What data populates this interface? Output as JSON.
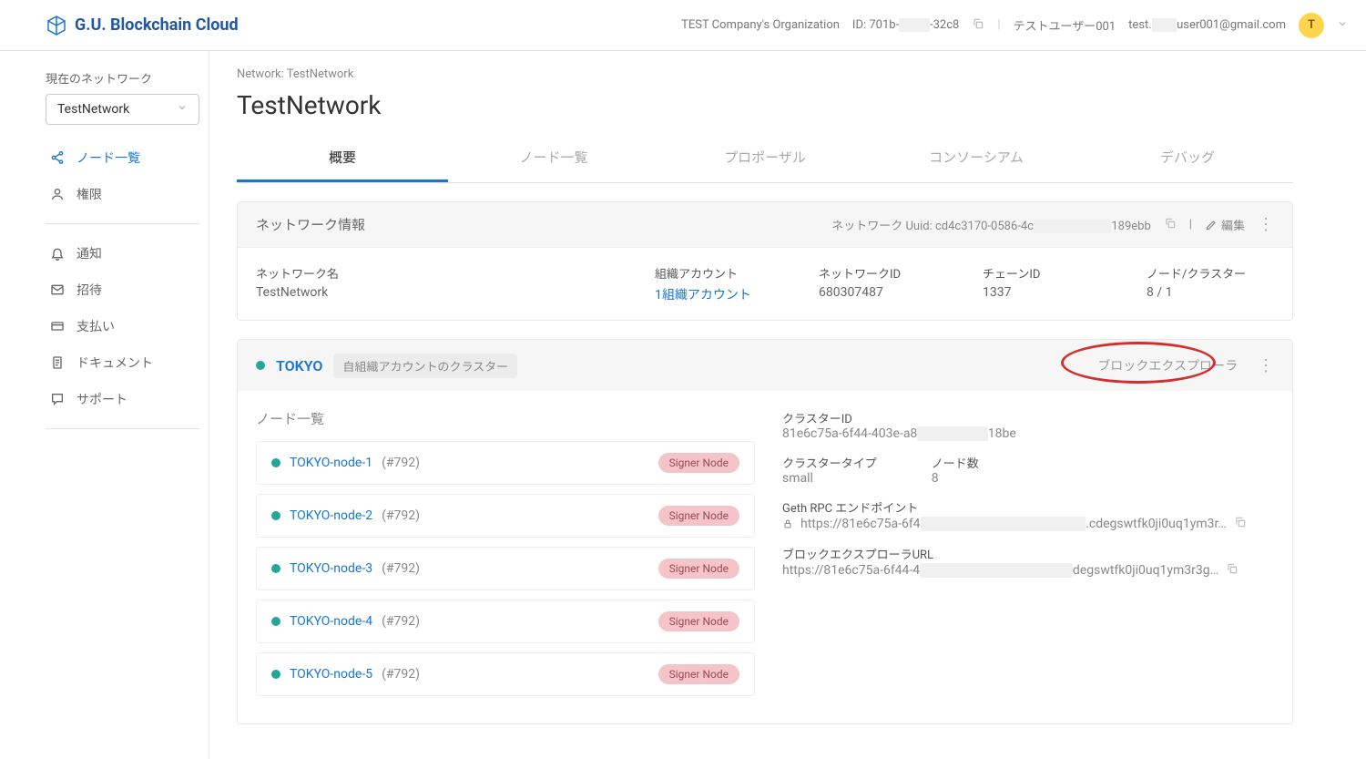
{
  "brand": "G.U. Blockchain Cloud",
  "header": {
    "org_name": "TEST Company's Organization",
    "org_id_label": "ID:",
    "org_id_prefix": "701b-",
    "org_id_suffix": "-32c8",
    "user_name": "テストユーザー001",
    "user_email_prefix": "test.",
    "user_email_suffix": "user001@gmail.com",
    "avatar_initial": "T"
  },
  "sidebar": {
    "current_network_label": "現在のネットワーク",
    "network_select_value": "TestNetwork",
    "items_top": [
      {
        "icon": "share-icon",
        "label": "ノード一覧",
        "active": true
      },
      {
        "icon": "person-icon",
        "label": "権限",
        "active": false
      }
    ],
    "items_bottom": [
      {
        "icon": "bell-icon",
        "label": "通知"
      },
      {
        "icon": "mail-icon",
        "label": "招待"
      },
      {
        "icon": "card-icon",
        "label": "支払い"
      },
      {
        "icon": "doc-icon",
        "label": "ドキュメント"
      },
      {
        "icon": "chat-icon",
        "label": "サポート"
      }
    ]
  },
  "breadcrumb": "Network: TestNetwork",
  "page_title": "TestNetwork",
  "tabs": [
    "概要",
    "ノード一覧",
    "プロポーザル",
    "コンソーシアム",
    "デバッグ"
  ],
  "network_info": {
    "title": "ネットワーク情報",
    "uuid_label": "ネットワーク Uuid:",
    "uuid_prefix": "cd4c3170-0586-4c",
    "uuid_suffix": "189ebb",
    "edit_label": "編集",
    "name_label": "ネットワーク名",
    "name_value": "TestNetwork",
    "org_account_label": "組織アカウント",
    "org_account_value": "1組織アカウント",
    "network_id_label": "ネットワークID",
    "network_id_value": "680307487",
    "chain_id_label": "チェーンID",
    "chain_id_value": "1337",
    "node_cluster_label": "ノード/クラスター",
    "node_cluster_value": "8 / 1"
  },
  "cluster": {
    "name": "TOKYO",
    "chip": "自組織アカウントのクラスター",
    "block_explorer_label": "ブロックエクスプローラ",
    "node_list_title": "ノード一覧",
    "nodes": [
      {
        "name": "TOKYO-node-1",
        "id": "(#792)",
        "badge": "Signer Node"
      },
      {
        "name": "TOKYO-node-2",
        "id": "(#792)",
        "badge": "Signer Node"
      },
      {
        "name": "TOKYO-node-3",
        "id": "(#792)",
        "badge": "Signer Node"
      },
      {
        "name": "TOKYO-node-4",
        "id": "(#792)",
        "badge": "Signer Node"
      },
      {
        "name": "TOKYO-node-5",
        "id": "(#792)",
        "badge": "Signer Node"
      }
    ],
    "info": {
      "cluster_id_label": "クラスターID",
      "cluster_id_prefix": "81e6c75a-6f44-403e-a8",
      "cluster_id_suffix": "18be",
      "cluster_type_label": "クラスタータイプ",
      "cluster_type_value": "small",
      "node_count_label": "ノード数",
      "node_count_value": "8",
      "rpc_label": "Geth RPC エンドポイント",
      "rpc_prefix": "https://81e6c75a-6f4",
      "rpc_suffix": ".cdegswtfk0ji0uq1ym3r…",
      "explorer_url_label": "ブロックエクスプローラURL",
      "explorer_url_prefix": "https://81e6c75a-6f44-4",
      "explorer_url_suffix": "degswtfk0ji0uq1ym3r3g…"
    }
  }
}
